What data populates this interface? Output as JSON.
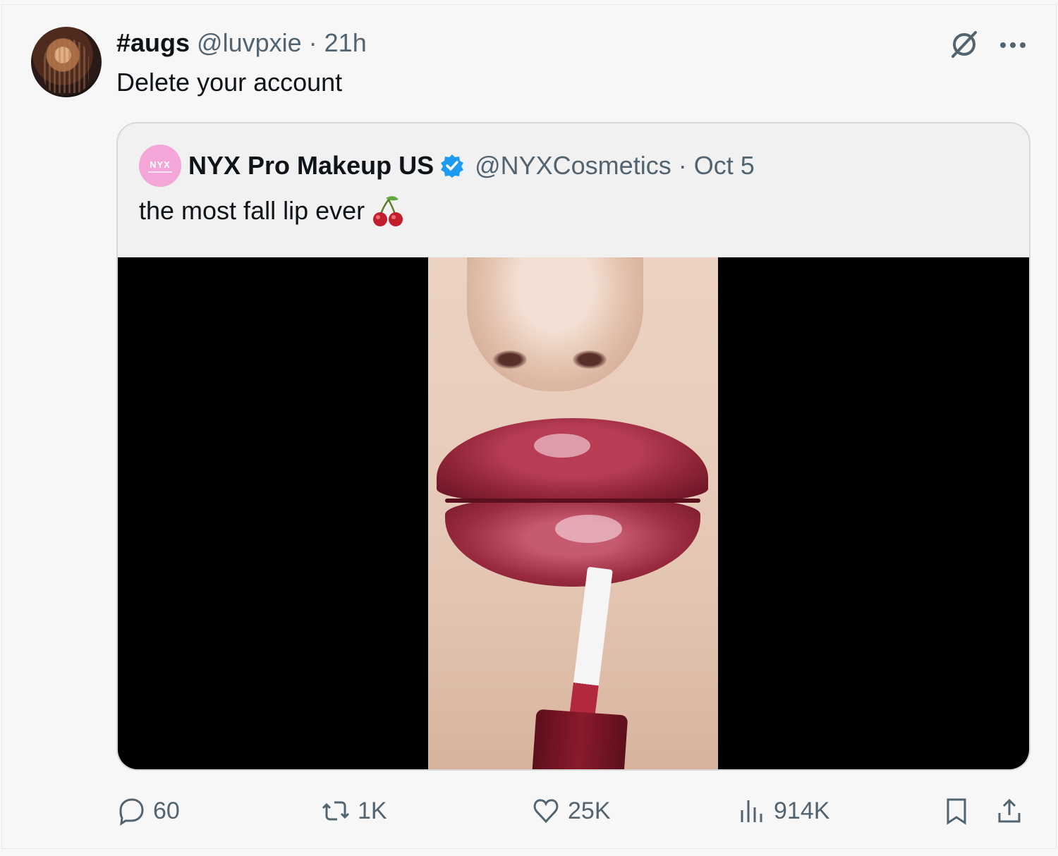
{
  "tweet": {
    "display_name": "#augs",
    "handle": "@luvpxie",
    "separator": "·",
    "time": "21h",
    "text": "Delete your account",
    "avatar_icon": "user-avatar-photo",
    "grok_icon": "grok-icon",
    "more_icon": "more-dots-icon"
  },
  "quote": {
    "avatar_logo": "NYX",
    "display_name": "NYX Pro Makeup US",
    "verified_icon": "verified-badge-icon",
    "verified_color": "#1d9bf0",
    "handle": "@NYXCosmetics",
    "separator": "·",
    "date": "Oct 5",
    "text": "the most fall lip ever",
    "emoji_icon": "cherry-icon",
    "media_description_icon": "video-thumbnail"
  },
  "actions": {
    "reply_count": "60",
    "repost_count": "1K",
    "like_count": "25K",
    "views_count": "914K",
    "icons": [
      "reply-icon",
      "repost-icon",
      "like-icon",
      "views-icon",
      "bookmark-icon",
      "share-icon"
    ]
  },
  "colors": {
    "background": "#f7f7f7",
    "secondary_text": "#536471",
    "primary_text": "#0f1419"
  }
}
